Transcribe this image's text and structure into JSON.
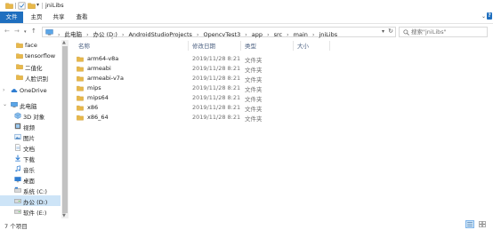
{
  "window": {
    "title": "jniLibs",
    "quick_access_dropdown": "▾"
  },
  "ribbon": {
    "tabs": [
      "文件",
      "主页",
      "共享",
      "查看"
    ]
  },
  "navigation": {
    "back": "←",
    "forward": "→",
    "recent": "▾",
    "up": "↑",
    "breadcrumbs": [
      "此电脑",
      "办公 (D:)",
      "AndroidStudioProjects",
      "OpencvTest3",
      "app",
      "src",
      "main",
      "jniLibs"
    ],
    "address_dropdown": "▾",
    "refresh": "↻",
    "search_placeholder": "搜索\"jniLibs\""
  },
  "sidebar": {
    "items": [
      {
        "label": "face",
        "icon": "folder-icon"
      },
      {
        "label": "tensorflow",
        "icon": "folder-icon"
      },
      {
        "label": "二值化",
        "icon": "folder-icon"
      },
      {
        "label": "人脸识别",
        "icon": "folder-icon"
      },
      {
        "label": "OneDrive",
        "icon": "cloud-icon"
      },
      {
        "label": "此电脑",
        "icon": "computer-icon"
      },
      {
        "label": "3D 对象",
        "icon": "cube-icon"
      },
      {
        "label": "视频",
        "icon": "video-icon"
      },
      {
        "label": "图片",
        "icon": "picture-icon"
      },
      {
        "label": "文档",
        "icon": "document-icon"
      },
      {
        "label": "下载",
        "icon": "download-icon"
      },
      {
        "label": "音乐",
        "icon": "music-icon"
      },
      {
        "label": "桌面",
        "icon": "desktop-icon"
      },
      {
        "label": "系统 (C:)",
        "icon": "drive-icon"
      },
      {
        "label": "办公 (D:)",
        "icon": "drive-icon"
      },
      {
        "label": "软件 (E:)",
        "icon": "drive-icon"
      }
    ]
  },
  "columns": {
    "name": "名称",
    "date": "修改日期",
    "type": "类型",
    "size": "大小"
  },
  "files": [
    {
      "name": "arm64-v8a",
      "date": "2019/11/28 8:21",
      "type": "文件夹"
    },
    {
      "name": "armeabi",
      "date": "2019/11/28 8:21",
      "type": "文件夹"
    },
    {
      "name": "armeabi-v7a",
      "date": "2019/11/28 8:21",
      "type": "文件夹"
    },
    {
      "name": "mips",
      "date": "2019/11/28 8:21",
      "type": "文件夹"
    },
    {
      "name": "mips64",
      "date": "2019/11/28 8:21",
      "type": "文件夹"
    },
    {
      "name": "x86",
      "date": "2019/11/28 8:21",
      "type": "文件夹"
    },
    {
      "name": "x86_64",
      "date": "2019/11/28 8:21",
      "type": "文件夹"
    }
  ],
  "status": {
    "item_count": "7 个项目"
  },
  "colors": {
    "accent": "#1f6fbf",
    "folder": "#e8b84a",
    "selection": "#cde4f7"
  }
}
